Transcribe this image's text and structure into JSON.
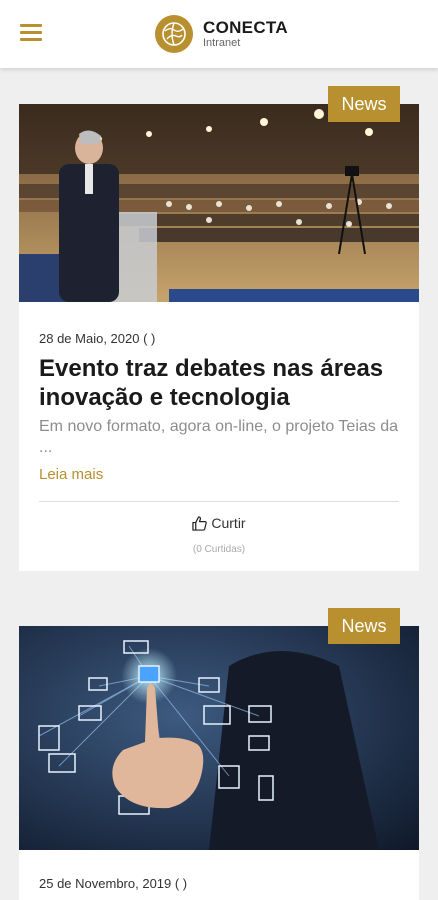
{
  "header": {
    "brand_name": "CONECTA",
    "brand_sub": "Intranet"
  },
  "posts": [
    {
      "badge": "News",
      "date": "28 de Maio, 2020 ( )",
      "title": "Evento traz debates nas áreas inovação e tecnologia",
      "excerpt": "Em novo formato, agora on-line, o projeto Teias da ...",
      "read_more": "Leia mais",
      "like_label": "Curtir",
      "like_count": "(0 Curtidas)",
      "image": "conference-speaker-photo"
    },
    {
      "badge": "News",
      "date": "25 de Novembro, 2019 ( )",
      "image": "technology-network-photo"
    }
  ],
  "colors": {
    "accent": "#b8902f",
    "background": "#efefef"
  }
}
